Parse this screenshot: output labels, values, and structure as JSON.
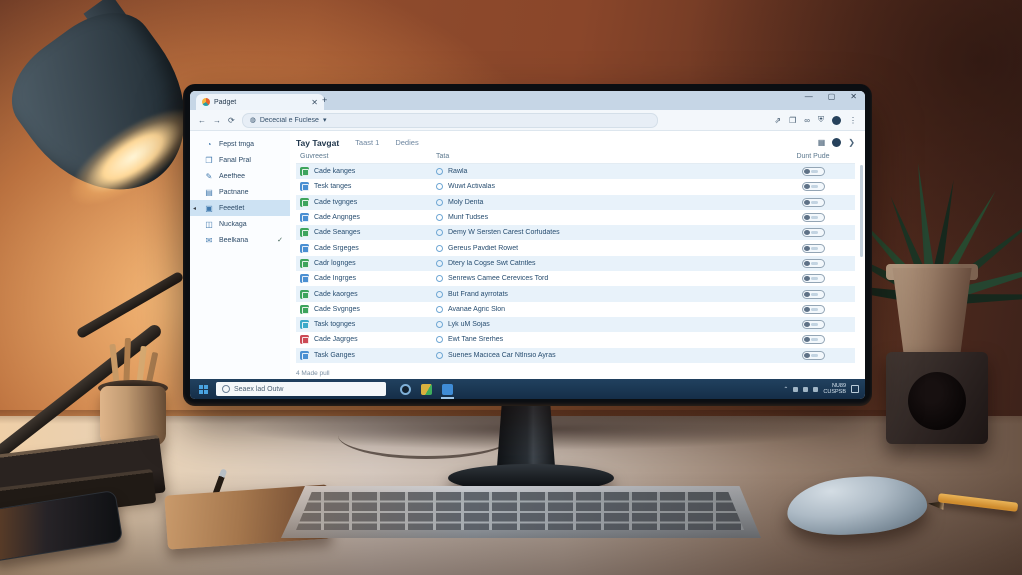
{
  "colors": {
    "icon_green": "#3da45c",
    "icon_blue": "#4a8fd2",
    "icon_teal": "#3aa9c9",
    "icon_red": "#cc4a55",
    "selection_blue": "#cde2f3",
    "row_alt_blue": "#e8f2fa",
    "taskbar_blue": "#1c3a58",
    "favicon_orange": "#e8622c",
    "favicon_teal": "#2a9da5"
  },
  "browser": {
    "tab": {
      "title": "Padget",
      "close_glyph": "✕",
      "new_tab_glyph": "+"
    },
    "window_controls": {
      "minimize": "—",
      "maximize": "▢",
      "close": "✕"
    },
    "toolbar": {
      "back_glyph": "←",
      "forward_glyph": "→",
      "refresh_glyph": "⟳",
      "site_icon_glyph": "◍",
      "url": "Dececial e Fuclese",
      "url_caret": "▾",
      "right_icons": [
        "⇗",
        "❐",
        "∞",
        "⛨"
      ],
      "menu_glyph": "⋮"
    },
    "sidebar": {
      "selected_marker": "◂",
      "check_marker": "✓",
      "items": [
        {
          "label": "Fepst tmga",
          "icon": "◔",
          "selected": false,
          "checked": false
        },
        {
          "label": "Fanal Pral",
          "icon": "❐",
          "selected": false,
          "checked": false
        },
        {
          "label": "Aeefhee",
          "icon": "✎",
          "selected": false,
          "checked": false
        },
        {
          "label": "Pactnane",
          "icon": "▤",
          "selected": false,
          "checked": false
        },
        {
          "label": "Feeetlet",
          "icon": "▣",
          "selected": true,
          "checked": false
        },
        {
          "label": "Nuckaga",
          "icon": "◫",
          "selected": false,
          "checked": false
        },
        {
          "label": "Beelkana",
          "icon": "✉",
          "selected": false,
          "checked": true
        }
      ]
    },
    "main": {
      "title": "Tay Tavgat",
      "tabs": [
        "Taast 1",
        "Dedies"
      ],
      "header_icons": {
        "grid": "▦",
        "caret": "❯"
      },
      "columns": [
        "Guvreest",
        "Tata",
        "Dunt Pude"
      ],
      "rows": [
        {
          "icon_color": "green",
          "app": "Cade kanges",
          "task": "Rawla"
        },
        {
          "icon_color": "blue",
          "app": "Tesk tanges",
          "task": "Wuwt Activalas"
        },
        {
          "icon_color": "green",
          "app": "Cade tvgnges",
          "task": "Moly Denta"
        },
        {
          "icon_color": "blue",
          "app": "Cade Angnges",
          "task": "Munf Tudses"
        },
        {
          "icon_color": "green",
          "app": "Cade Seanges",
          "task": "Demy W Sersten Carest Corfudates"
        },
        {
          "icon_color": "blue",
          "app": "Cade Srgeges",
          "task": "Gereus Pavdiet Rowet"
        },
        {
          "icon_color": "green",
          "app": "Cadr lognges",
          "task": "Dtery la Cogse Swt Catntles"
        },
        {
          "icon_color": "blue",
          "app": "Cade Ingrges",
          "task": "Senrews Camee Cerevices Tord"
        },
        {
          "icon_color": "green",
          "app": "Cade kaorges",
          "task": "But Frand ayrrotats"
        },
        {
          "icon_color": "green",
          "app": "Cade Svgnges",
          "task": "Avanae Agric Slon"
        },
        {
          "icon_color": "teal",
          "app": "Task tognges",
          "task": "Lyk uM Sojas"
        },
        {
          "icon_color": "red",
          "app": "Cade Jagrges",
          "task": "Ewt Tane Srerhes"
        },
        {
          "icon_color": "blue",
          "app": "Task Ganges",
          "task": "Suenes Macicea Car Ntlnsio Ayras"
        }
      ],
      "footer": "4  Made pull"
    }
  },
  "taskbar": {
    "search_text": "Seaex lad Outw",
    "tray_caret": "⌃",
    "clock_line1": "NU89",
    "clock_line2": "CUSPSB"
  }
}
